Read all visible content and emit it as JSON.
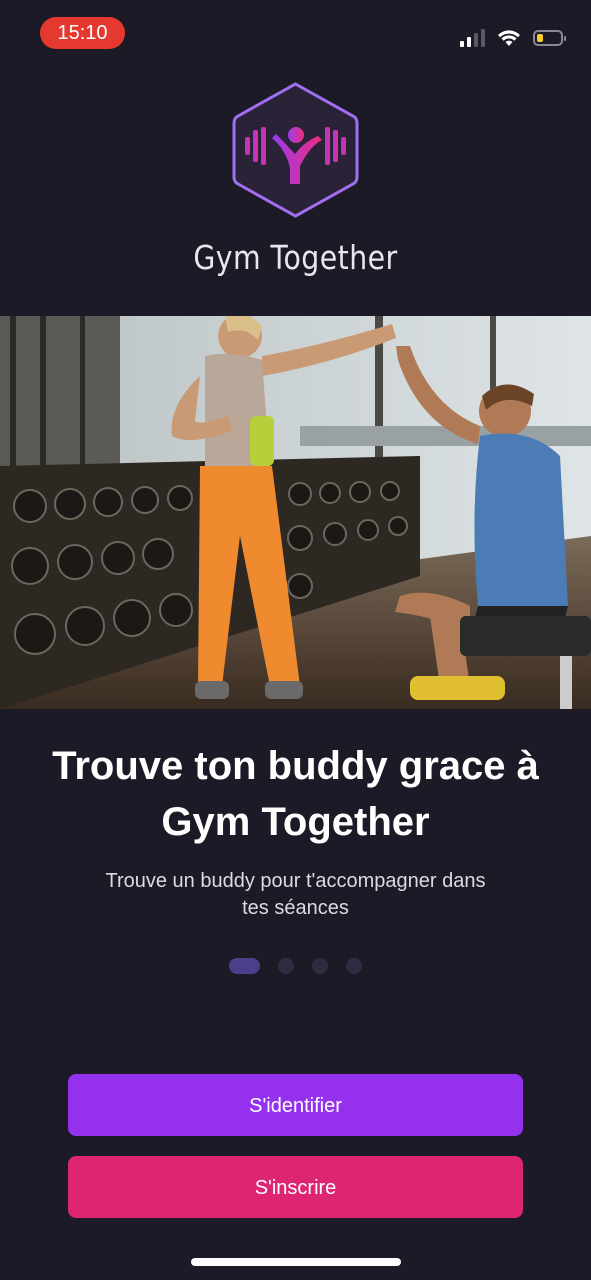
{
  "status_bar": {
    "time": "15:10",
    "battery_level": 0.25,
    "colors": {
      "time_pill": "#e5392f",
      "battery_fill": "#f5d02a"
    }
  },
  "app": {
    "name": "Gym Together",
    "logo_icon": "dumbbell-buddy-logo-icon",
    "colors": {
      "logo_outline": "#a26ef2",
      "logo_gradient_start": "#9b3cf0",
      "logo_gradient_end": "#ee2c7c"
    }
  },
  "onboarding": {
    "hero_icon": "gym-high-five-photo",
    "headline": "Trouve ton buddy grace à Gym Together",
    "subtext": "Trouve un buddy pour t'accompagner dans tes séances",
    "pagination": {
      "current": 1,
      "total": 4
    }
  },
  "actions": {
    "login_label": "S'identifier",
    "signup_label": "S'inscrire",
    "colors": {
      "login": "#9531ee",
      "signup": "#dd2573",
      "background": "#1c1a26"
    }
  }
}
